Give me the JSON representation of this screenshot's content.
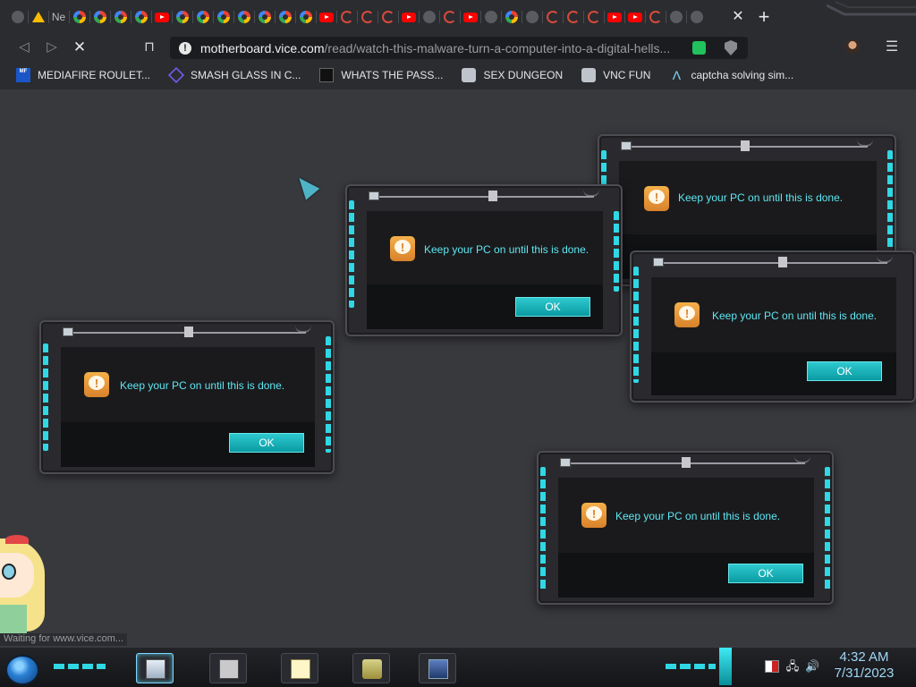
{
  "browser": {
    "tab_label_partial": "Ne",
    "url_host": "motherboard.vice.com",
    "url_path": "/read/watch-this-malware-turn-a-computer-into-a-digital-hells...",
    "status": "Waiting for www.vice.com..."
  },
  "bookmarks": [
    {
      "icon": "mediafire-icon",
      "label": "MEDIAFIRE ROULET..."
    },
    {
      "icon": "glass-icon",
      "label": "SMASH GLASS IN C..."
    },
    {
      "icon": "password-icon",
      "label": "WHATS THE PASS..."
    },
    {
      "icon": "dungeon-icon",
      "label": "SEX DUNGEON"
    },
    {
      "icon": "vnc-icon",
      "label": "VNC FUN"
    },
    {
      "icon": "captcha-icon",
      "label": "captcha solving sim..."
    }
  ],
  "dialogs": [
    {
      "message": "Keep your PC on until this is done.",
      "ok": "OK"
    },
    {
      "message": "Keep your PC on until this is done.",
      "ok": "OK"
    },
    {
      "message": "Keep your PC on until this is done.",
      "ok": "OK"
    },
    {
      "message": "Keep your PC on until this is done.",
      "ok": "OK"
    },
    {
      "message": "Keep your PC on until this is done.",
      "ok": "OK"
    }
  ],
  "taskbar": {
    "time": "4:32 AM",
    "date": "7/31/2023"
  },
  "colors": {
    "accent_cyan": "#2fd8e4",
    "dialog_text": "#5fe7f2",
    "ok_button": "#0fb2b8",
    "desktop": "#38393d"
  }
}
